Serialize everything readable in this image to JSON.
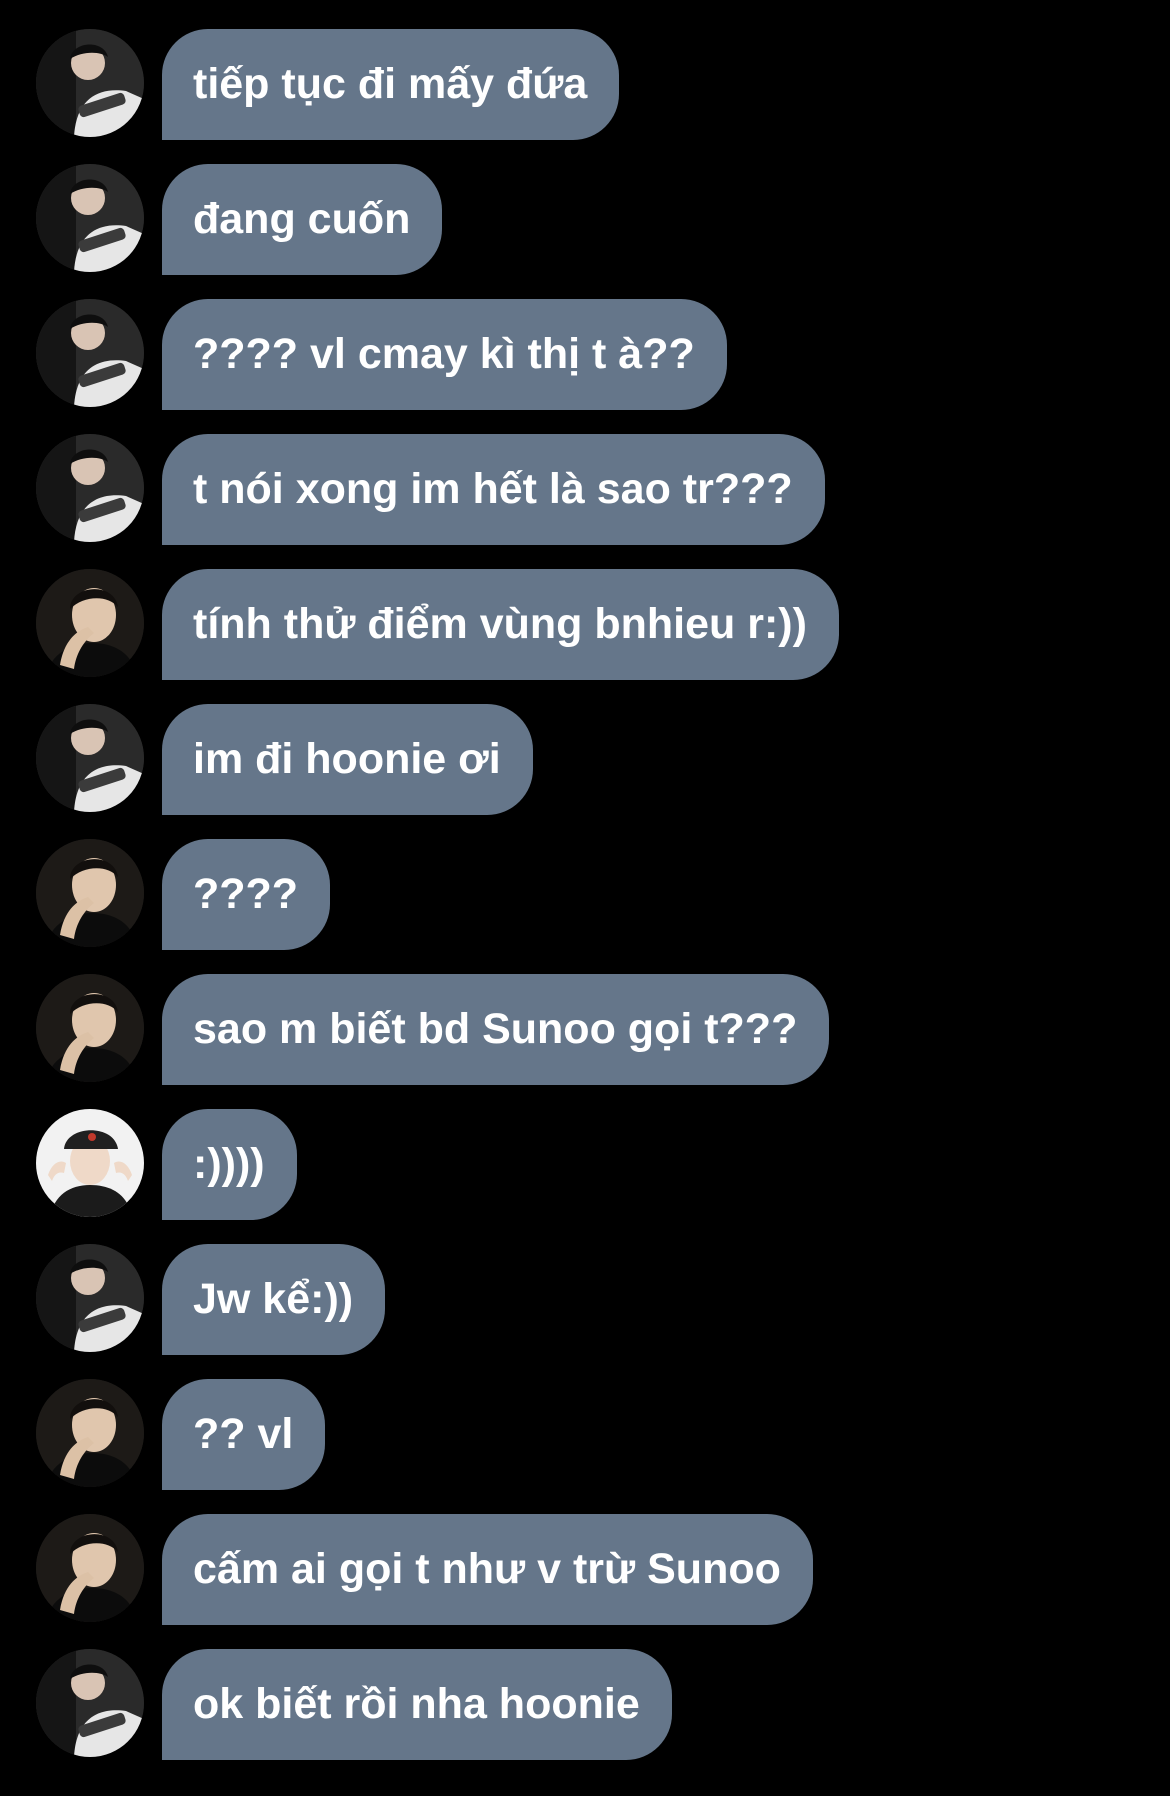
{
  "colors": {
    "background": "#000000",
    "bubble": "#65768a",
    "text": "#ffffff"
  },
  "avatars": {
    "a": "avatar-guitar-player",
    "b": "avatar-hand-on-face",
    "c": "avatar-red-cap"
  },
  "messages": [
    {
      "avatar": "a",
      "text": "tiếp tục đi mấy đứa"
    },
    {
      "avatar": "a",
      "text": "đang cuốn"
    },
    {
      "avatar": "a",
      "text": "???? vl cmay kì thị t à??"
    },
    {
      "avatar": "a",
      "text": "t nói xong im hết là sao tr???"
    },
    {
      "avatar": "b",
      "text": "tính thử điểm vùng bnhieu r:))"
    },
    {
      "avatar": "a",
      "text": "im đi hoonie ơi"
    },
    {
      "avatar": "b",
      "text": "????"
    },
    {
      "avatar": "b",
      "text": "sao m biết bd Sunoo gọi t???"
    },
    {
      "avatar": "c",
      "text": ":))))"
    },
    {
      "avatar": "a",
      "text": "Jw kể:))"
    },
    {
      "avatar": "b",
      "text": "?? vl"
    },
    {
      "avatar": "b",
      "text": "cấm ai gọi t như v trừ Sunoo"
    },
    {
      "avatar": "a",
      "text": "ok biết rồi nha hoonie"
    }
  ]
}
